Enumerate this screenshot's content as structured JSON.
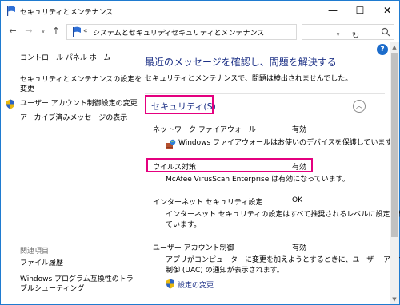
{
  "window": {
    "title": "セキュリティとメンテナンス",
    "min_glyph": "—",
    "max_glyph": "☐",
    "close_glyph": "✕"
  },
  "nav": {
    "back_glyph": "←",
    "forward_glyph": "→",
    "dropdown_glyph": "∨",
    "up_glyph": "↑",
    "crumb_sep0": "«",
    "crumb1": "システムとセキュリティ",
    "crumb_sep": "›",
    "crumb2": "セキュリティとメンテナンス",
    "addr_dropdown_glyph": "∨",
    "refresh_glyph": "↻",
    "search_placeholder": ""
  },
  "sidebar": {
    "home": "コントロール パネル ホーム",
    "settings_line1": "セキュリティとメンテナンスの設定を",
    "settings_line2": "変更",
    "uac": "ユーザー アカウント制御設定の変更",
    "archive": "アーカイブ済みメッセージの表示",
    "see_also": "関連項目",
    "file_history": "ファイル履歴",
    "compat_line1": "Windows プログラム互換性のトラ",
    "compat_line2": "ブルシューティング"
  },
  "main": {
    "heading": "最近のメッセージを確認し、問題を解決する",
    "status": "セキュリティとメンテナンスで、問題は検出されませんでした。",
    "security_title": "セキュリティ(S)",
    "collapse_glyph": "︿",
    "items": [
      {
        "label": "ネットワーク ファイアウォール",
        "value": "有効",
        "desc": "Windows ファイアウォールはお使いのデバイスを保護しています。"
      },
      {
        "label": "ウイルス対策",
        "value": "有効",
        "desc": "McAfee VirusScan Enterprise は有効になっています。"
      },
      {
        "label": "インターネット セキュリティ設定",
        "value": "OK",
        "desc_line1": "インターネット セキュリティの設定はすべて推奨されるレベルに設定され",
        "desc_line2": "ています。"
      },
      {
        "label": "ユーザー アカウント制御",
        "value": "有効",
        "desc_line1": "アプリがコンピューターに変更を加えようとするときに、ユーザー アカウント",
        "desc_line2": "制御 (UAC) の通知が表示されます。",
        "link": "設定の変更"
      }
    ]
  },
  "help_glyph": "?",
  "scroll": {
    "up_glyph": "▲",
    "down_glyph": "▼"
  },
  "colors": {
    "accent": "#1e3287",
    "highlight_box": "#e4007f",
    "window_border": "#1f7bd0"
  }
}
